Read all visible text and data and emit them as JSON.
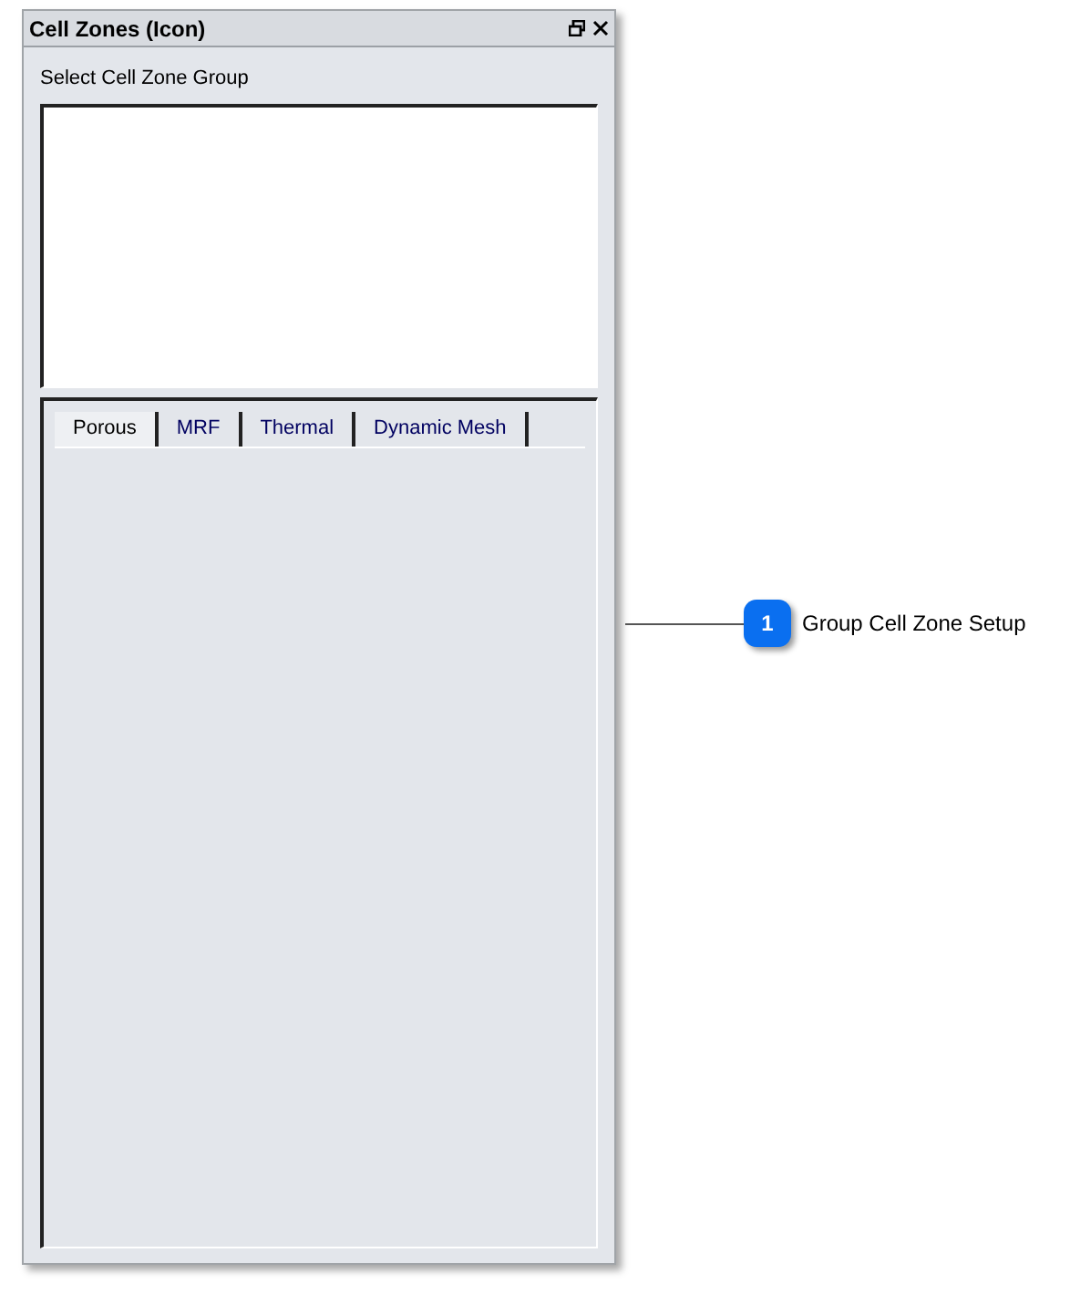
{
  "panel": {
    "title": "Cell Zones (Icon)",
    "group_label": "Select Cell Zone Group"
  },
  "tabs": [
    {
      "label": "Porous",
      "selected": true
    },
    {
      "label": "MRF",
      "selected": false
    },
    {
      "label": "Thermal",
      "selected": false
    },
    {
      "label": "Dynamic Mesh",
      "selected": false
    }
  ],
  "callout": {
    "number": "1",
    "text": "Group Cell Zone Setup"
  }
}
